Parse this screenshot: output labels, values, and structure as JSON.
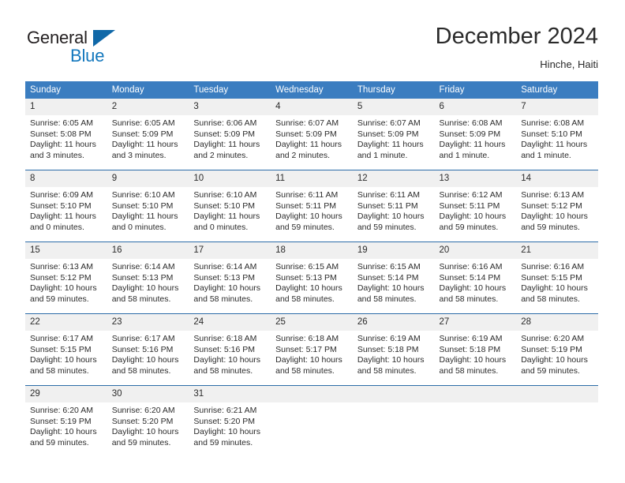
{
  "brand": {
    "name_part1": "General",
    "name_part2": "Blue",
    "accent_color": "#1277bd",
    "triangle_color": "#1068a8"
  },
  "header": {
    "title": "December 2024",
    "location": "Hinche, Haiti"
  },
  "theme": {
    "header_row_bg": "#3b7dc0",
    "week_rule_color": "#2c6ca8",
    "daynum_bg": "#f0f0f0",
    "text_color": "#2b2b2b"
  },
  "weekday_headers": [
    "Sunday",
    "Monday",
    "Tuesday",
    "Wednesday",
    "Thursday",
    "Friday",
    "Saturday"
  ],
  "labels": {
    "sunrise_prefix": "Sunrise:",
    "sunset_prefix": "Sunset:",
    "daylight_prefix": "Daylight:"
  },
  "weeks": [
    [
      {
        "day": "1",
        "sunrise": "Sunrise: 6:05 AM",
        "sunset": "Sunset: 5:08 PM",
        "daylight_line1": "Daylight: 11 hours",
        "daylight_line2": "and 3 minutes."
      },
      {
        "day": "2",
        "sunrise": "Sunrise: 6:05 AM",
        "sunset": "Sunset: 5:09 PM",
        "daylight_line1": "Daylight: 11 hours",
        "daylight_line2": "and 3 minutes."
      },
      {
        "day": "3",
        "sunrise": "Sunrise: 6:06 AM",
        "sunset": "Sunset: 5:09 PM",
        "daylight_line1": "Daylight: 11 hours",
        "daylight_line2": "and 2 minutes."
      },
      {
        "day": "4",
        "sunrise": "Sunrise: 6:07 AM",
        "sunset": "Sunset: 5:09 PM",
        "daylight_line1": "Daylight: 11 hours",
        "daylight_line2": "and 2 minutes."
      },
      {
        "day": "5",
        "sunrise": "Sunrise: 6:07 AM",
        "sunset": "Sunset: 5:09 PM",
        "daylight_line1": "Daylight: 11 hours",
        "daylight_line2": "and 1 minute."
      },
      {
        "day": "6",
        "sunrise": "Sunrise: 6:08 AM",
        "sunset": "Sunset: 5:09 PM",
        "daylight_line1": "Daylight: 11 hours",
        "daylight_line2": "and 1 minute."
      },
      {
        "day": "7",
        "sunrise": "Sunrise: 6:08 AM",
        "sunset": "Sunset: 5:10 PM",
        "daylight_line1": "Daylight: 11 hours",
        "daylight_line2": "and 1 minute."
      }
    ],
    [
      {
        "day": "8",
        "sunrise": "Sunrise: 6:09 AM",
        "sunset": "Sunset: 5:10 PM",
        "daylight_line1": "Daylight: 11 hours",
        "daylight_line2": "and 0 minutes."
      },
      {
        "day": "9",
        "sunrise": "Sunrise: 6:10 AM",
        "sunset": "Sunset: 5:10 PM",
        "daylight_line1": "Daylight: 11 hours",
        "daylight_line2": "and 0 minutes."
      },
      {
        "day": "10",
        "sunrise": "Sunrise: 6:10 AM",
        "sunset": "Sunset: 5:10 PM",
        "daylight_line1": "Daylight: 11 hours",
        "daylight_line2": "and 0 minutes."
      },
      {
        "day": "11",
        "sunrise": "Sunrise: 6:11 AM",
        "sunset": "Sunset: 5:11 PM",
        "daylight_line1": "Daylight: 10 hours",
        "daylight_line2": "and 59 minutes."
      },
      {
        "day": "12",
        "sunrise": "Sunrise: 6:11 AM",
        "sunset": "Sunset: 5:11 PM",
        "daylight_line1": "Daylight: 10 hours",
        "daylight_line2": "and 59 minutes."
      },
      {
        "day": "13",
        "sunrise": "Sunrise: 6:12 AM",
        "sunset": "Sunset: 5:11 PM",
        "daylight_line1": "Daylight: 10 hours",
        "daylight_line2": "and 59 minutes."
      },
      {
        "day": "14",
        "sunrise": "Sunrise: 6:13 AM",
        "sunset": "Sunset: 5:12 PM",
        "daylight_line1": "Daylight: 10 hours",
        "daylight_line2": "and 59 minutes."
      }
    ],
    [
      {
        "day": "15",
        "sunrise": "Sunrise: 6:13 AM",
        "sunset": "Sunset: 5:12 PM",
        "daylight_line1": "Daylight: 10 hours",
        "daylight_line2": "and 59 minutes."
      },
      {
        "day": "16",
        "sunrise": "Sunrise: 6:14 AM",
        "sunset": "Sunset: 5:13 PM",
        "daylight_line1": "Daylight: 10 hours",
        "daylight_line2": "and 58 minutes."
      },
      {
        "day": "17",
        "sunrise": "Sunrise: 6:14 AM",
        "sunset": "Sunset: 5:13 PM",
        "daylight_line1": "Daylight: 10 hours",
        "daylight_line2": "and 58 minutes."
      },
      {
        "day": "18",
        "sunrise": "Sunrise: 6:15 AM",
        "sunset": "Sunset: 5:13 PM",
        "daylight_line1": "Daylight: 10 hours",
        "daylight_line2": "and 58 minutes."
      },
      {
        "day": "19",
        "sunrise": "Sunrise: 6:15 AM",
        "sunset": "Sunset: 5:14 PM",
        "daylight_line1": "Daylight: 10 hours",
        "daylight_line2": "and 58 minutes."
      },
      {
        "day": "20",
        "sunrise": "Sunrise: 6:16 AM",
        "sunset": "Sunset: 5:14 PM",
        "daylight_line1": "Daylight: 10 hours",
        "daylight_line2": "and 58 minutes."
      },
      {
        "day": "21",
        "sunrise": "Sunrise: 6:16 AM",
        "sunset": "Sunset: 5:15 PM",
        "daylight_line1": "Daylight: 10 hours",
        "daylight_line2": "and 58 minutes."
      }
    ],
    [
      {
        "day": "22",
        "sunrise": "Sunrise: 6:17 AM",
        "sunset": "Sunset: 5:15 PM",
        "daylight_line1": "Daylight: 10 hours",
        "daylight_line2": "and 58 minutes."
      },
      {
        "day": "23",
        "sunrise": "Sunrise: 6:17 AM",
        "sunset": "Sunset: 5:16 PM",
        "daylight_line1": "Daylight: 10 hours",
        "daylight_line2": "and 58 minutes."
      },
      {
        "day": "24",
        "sunrise": "Sunrise: 6:18 AM",
        "sunset": "Sunset: 5:16 PM",
        "daylight_line1": "Daylight: 10 hours",
        "daylight_line2": "and 58 minutes."
      },
      {
        "day": "25",
        "sunrise": "Sunrise: 6:18 AM",
        "sunset": "Sunset: 5:17 PM",
        "daylight_line1": "Daylight: 10 hours",
        "daylight_line2": "and 58 minutes."
      },
      {
        "day": "26",
        "sunrise": "Sunrise: 6:19 AM",
        "sunset": "Sunset: 5:18 PM",
        "daylight_line1": "Daylight: 10 hours",
        "daylight_line2": "and 58 minutes."
      },
      {
        "day": "27",
        "sunrise": "Sunrise: 6:19 AM",
        "sunset": "Sunset: 5:18 PM",
        "daylight_line1": "Daylight: 10 hours",
        "daylight_line2": "and 58 minutes."
      },
      {
        "day": "28",
        "sunrise": "Sunrise: 6:20 AM",
        "sunset": "Sunset: 5:19 PM",
        "daylight_line1": "Daylight: 10 hours",
        "daylight_line2": "and 59 minutes."
      }
    ],
    [
      {
        "day": "29",
        "sunrise": "Sunrise: 6:20 AM",
        "sunset": "Sunset: 5:19 PM",
        "daylight_line1": "Daylight: 10 hours",
        "daylight_line2": "and 59 minutes."
      },
      {
        "day": "30",
        "sunrise": "Sunrise: 6:20 AM",
        "sunset": "Sunset: 5:20 PM",
        "daylight_line1": "Daylight: 10 hours",
        "daylight_line2": "and 59 minutes."
      },
      {
        "day": "31",
        "sunrise": "Sunrise: 6:21 AM",
        "sunset": "Sunset: 5:20 PM",
        "daylight_line1": "Daylight: 10 hours",
        "daylight_line2": "and 59 minutes."
      },
      null,
      null,
      null,
      null
    ]
  ]
}
